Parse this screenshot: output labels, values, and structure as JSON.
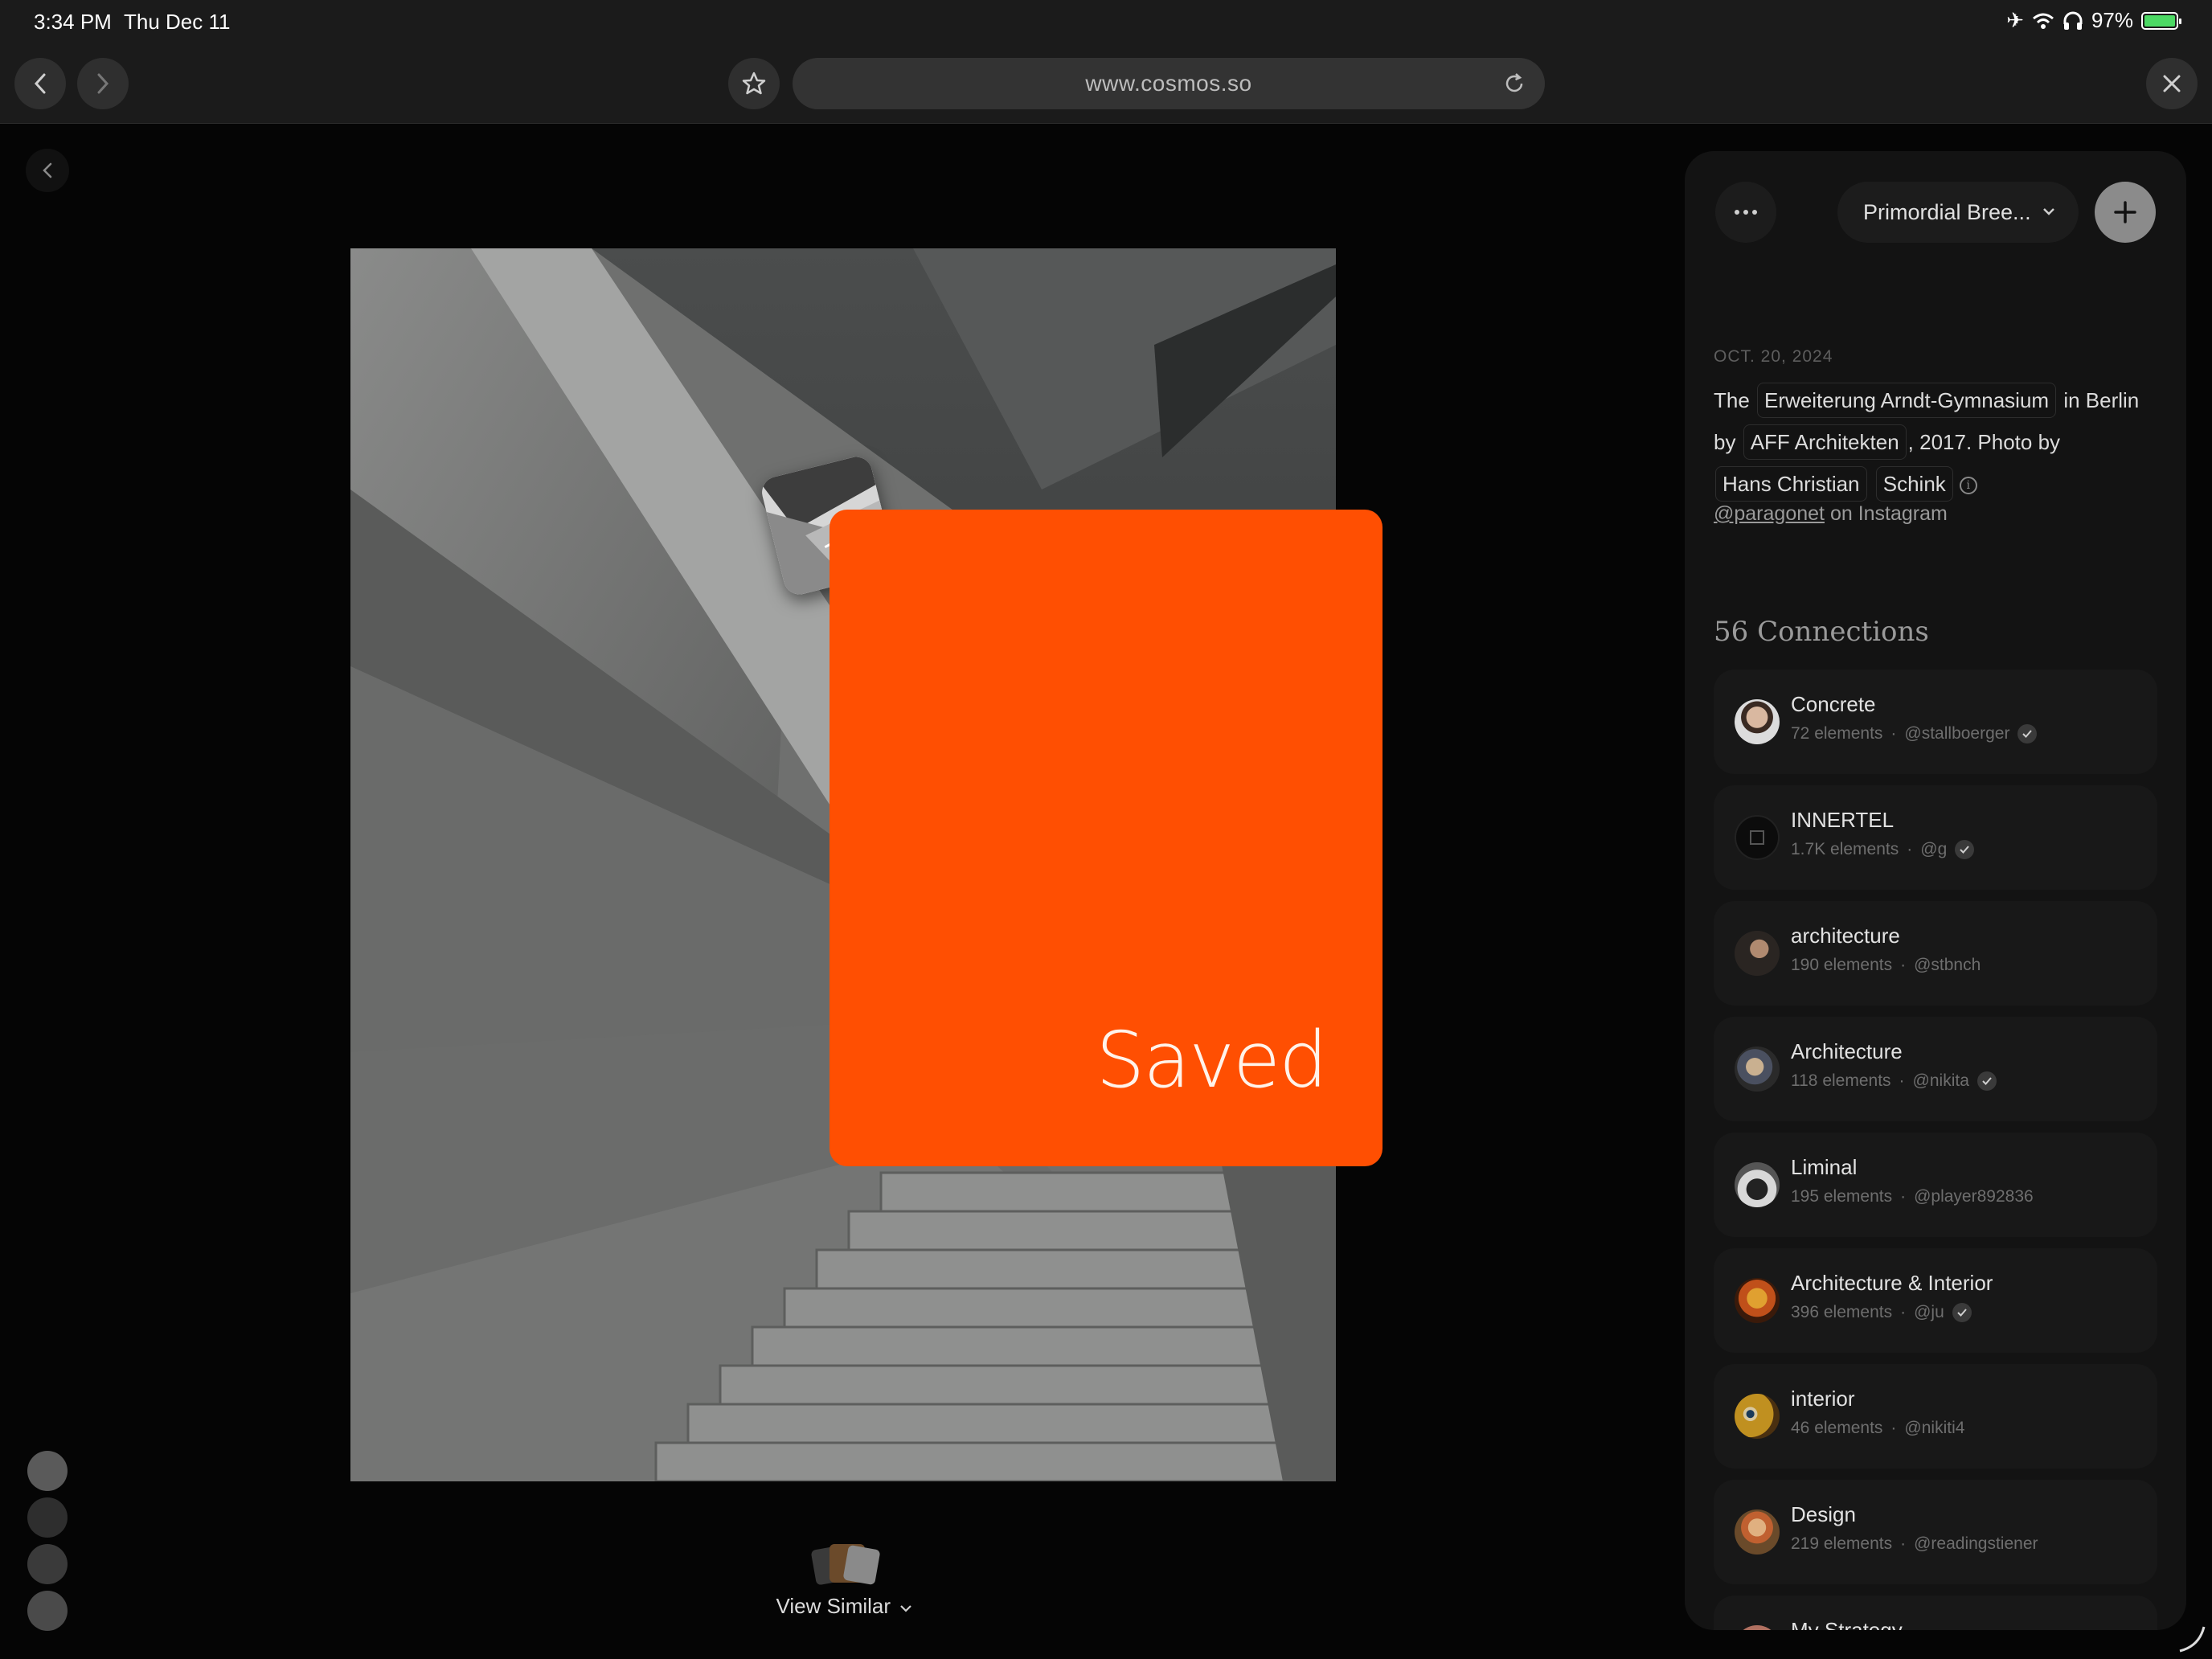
{
  "status_bar": {
    "time": "3:34 PM",
    "date": "Thu Dec 11",
    "battery": "97%"
  },
  "browser": {
    "url": "www.cosmos.so"
  },
  "viewer": {
    "saved_label": "Saved",
    "view_similar_label": "View Similar"
  },
  "sidebar": {
    "collection_name": "Primordial Bree...",
    "date": "OCT. 20, 2024",
    "description": {
      "w1": "The",
      "chip1": "Erweiterung Arndt-Gymnasium",
      "w2": "in Berlin by",
      "chip2": "AFF Architekten",
      "w3": ", 2017. Photo by",
      "chip3": "Hans Christian",
      "chip4": "Schink"
    },
    "credit_handle": "@paragonet",
    "credit_suffix": "on Instagram",
    "connections_title": "56 Connections",
    "connections": [
      {
        "name": "Concrete",
        "count": "72 elements",
        "sep": "·",
        "user": "@stallboerger",
        "verified": true
      },
      {
        "name": "INNERTEL",
        "count": "1.7K elements",
        "sep": "·",
        "user": "@g",
        "verified": true
      },
      {
        "name": "architecture",
        "count": "190 elements",
        "sep": "·",
        "user": "@stbnch",
        "verified": false
      },
      {
        "name": "Architecture",
        "count": "118 elements",
        "sep": "·",
        "user": "@nikita",
        "verified": true
      },
      {
        "name": "Liminal",
        "count": "195 elements",
        "sep": "·",
        "user": "@player892836",
        "verified": false
      },
      {
        "name": "Architecture & Interior",
        "count": "396 elements",
        "sep": "·",
        "user": "@ju",
        "verified": true
      },
      {
        "name": "interior",
        "count": "46 elements",
        "sep": "·",
        "user": "@nikiti4",
        "verified": false
      },
      {
        "name": "Design",
        "count": "219 elements",
        "sep": "·",
        "user": "@readingstiener",
        "verified": false
      },
      {
        "name": "My Strategy",
        "count": "",
        "sep": "",
        "user": "",
        "verified": false
      }
    ]
  },
  "colors": {
    "accent_orange": "#ff4f02",
    "background": "#050505",
    "panel": "#131313"
  }
}
